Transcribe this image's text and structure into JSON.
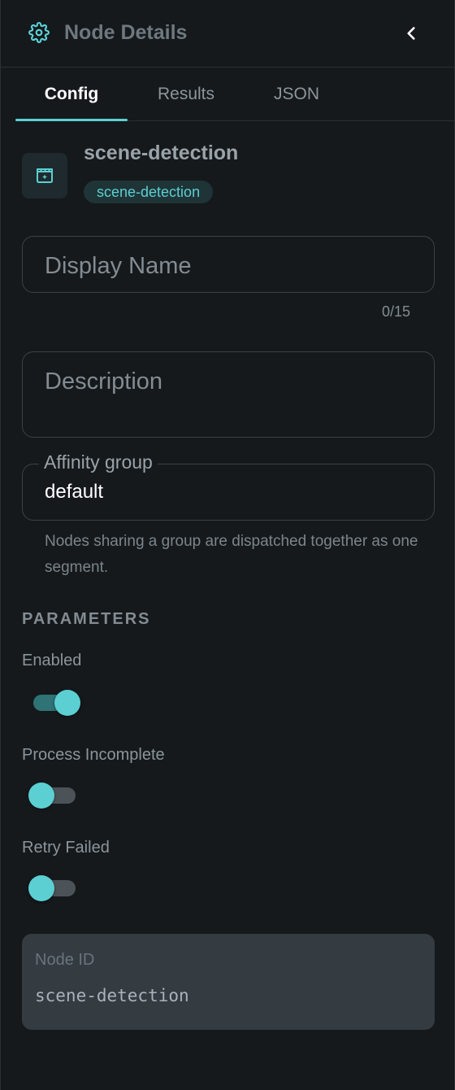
{
  "header": {
    "title": "Node Details",
    "icon": "gear-icon",
    "back_icon": "chevron-left-icon"
  },
  "tabs": [
    {
      "label": "Config",
      "active": true
    },
    {
      "label": "Results",
      "active": false
    },
    {
      "label": "JSON",
      "active": false
    }
  ],
  "node": {
    "name": "scene-detection",
    "type_chip": "scene-detection",
    "icon": "clapperboard-icon"
  },
  "form": {
    "display_name": {
      "placeholder": "Display Name",
      "value": "",
      "counter": "0/15"
    },
    "description": {
      "placeholder": "Description",
      "value": ""
    },
    "affinity": {
      "label": "Affinity group",
      "value": "default",
      "helper": "Nodes sharing a group are dispatched together as one segment."
    }
  },
  "parameters": {
    "title": "PARAMETERS",
    "items": [
      {
        "label": "Enabled",
        "on": true
      },
      {
        "label": "Process Incomplete",
        "on": false
      },
      {
        "label": "Retry Failed",
        "on": false
      }
    ]
  },
  "node_id": {
    "label": "Node ID",
    "value": "scene-detection"
  },
  "colors": {
    "accent": "#5ccfd3",
    "background": "#15191c",
    "card": "#343b41"
  }
}
